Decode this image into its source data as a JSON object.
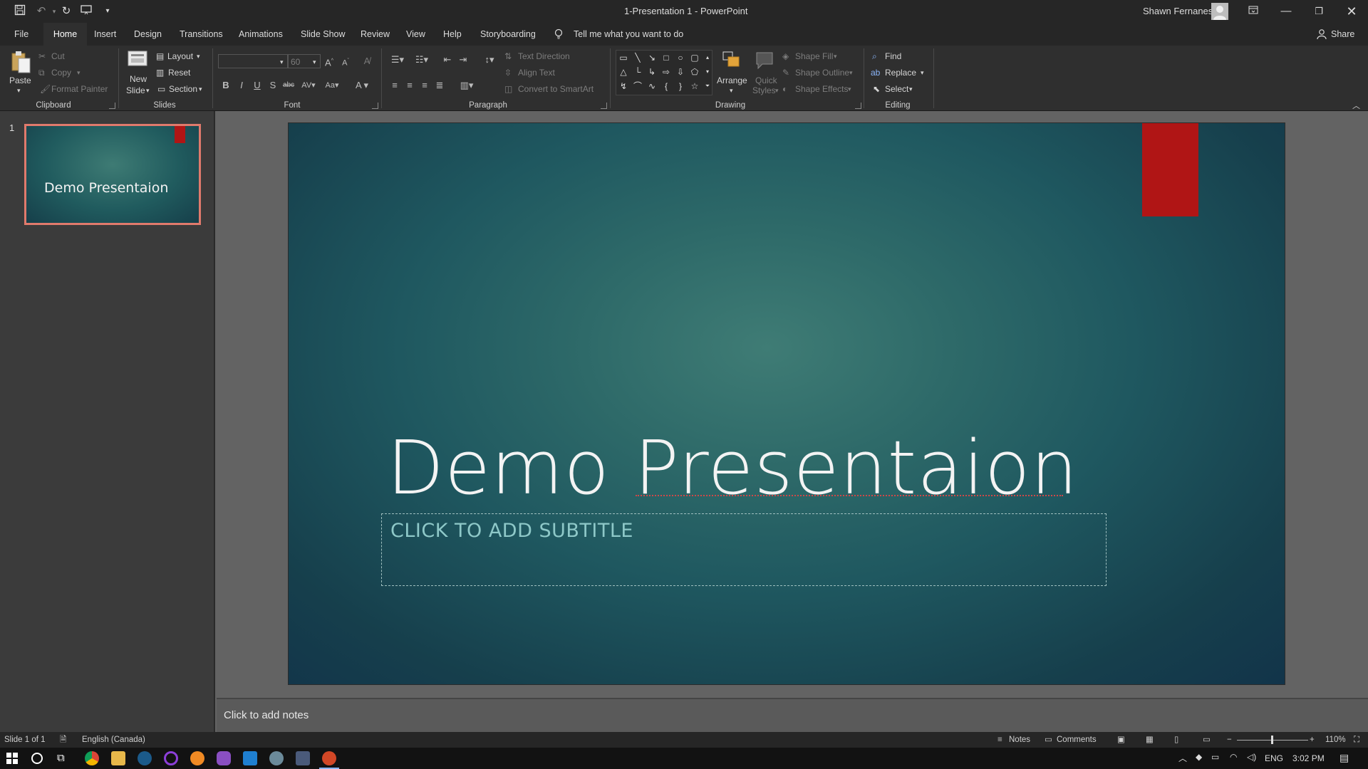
{
  "window": {
    "title": "1-Presentation 1  -  PowerPoint",
    "user_name": "Shawn Fernanes"
  },
  "tabs": [
    "File",
    "Home",
    "Insert",
    "Design",
    "Transitions",
    "Animations",
    "Slide Show",
    "Review",
    "View",
    "Help",
    "Storyboarding"
  ],
  "tell_me": "Tell me what you want to do",
  "share_label": "Share",
  "ribbon": {
    "clipboard": {
      "group": "Clipboard",
      "paste": "Paste",
      "cut": "Cut",
      "copy": "Copy",
      "format_painter": "Format Painter"
    },
    "slides": {
      "group": "Slides",
      "new_slide_1": "New",
      "new_slide_2": "Slide",
      "layout": "Layout",
      "reset": "Reset",
      "section": "Section"
    },
    "font": {
      "group": "Font",
      "font_name": "",
      "font_size": "60"
    },
    "paragraph": {
      "group": "Paragraph",
      "text_direction": "Text Direction",
      "align_text": "Align Text",
      "convert_smartart": "Convert to SmartArt"
    },
    "drawing": {
      "group": "Drawing",
      "arrange": "Arrange",
      "quick_styles_1": "Quick",
      "quick_styles_2": "Styles",
      "shape_fill": "Shape Fill",
      "shape_outline": "Shape Outline",
      "shape_effects": "Shape Effects"
    },
    "editing": {
      "group": "Editing",
      "find": "Find",
      "replace": "Replace",
      "select": "Select"
    }
  },
  "thumbnail": {
    "number": "1",
    "title": "Demo Presentaion"
  },
  "slide": {
    "title": "Demo Presentaion",
    "subtitle_placeholder": "CLICK TO ADD SUBTITLE",
    "accent_color": "#b01515"
  },
  "notes_placeholder": "Click to add notes",
  "status": {
    "slide_info": "Slide 1 of 1",
    "language": "English (Canada)",
    "notes": "Notes",
    "comments": "Comments",
    "zoom": "110%"
  },
  "taskbar": {
    "lang": "ENG",
    "time": "3:02 PM"
  },
  "colors": {
    "slide_bg": "#2e6a69",
    "thumb_border": "#e07a6c",
    "accent": "#b01515"
  }
}
